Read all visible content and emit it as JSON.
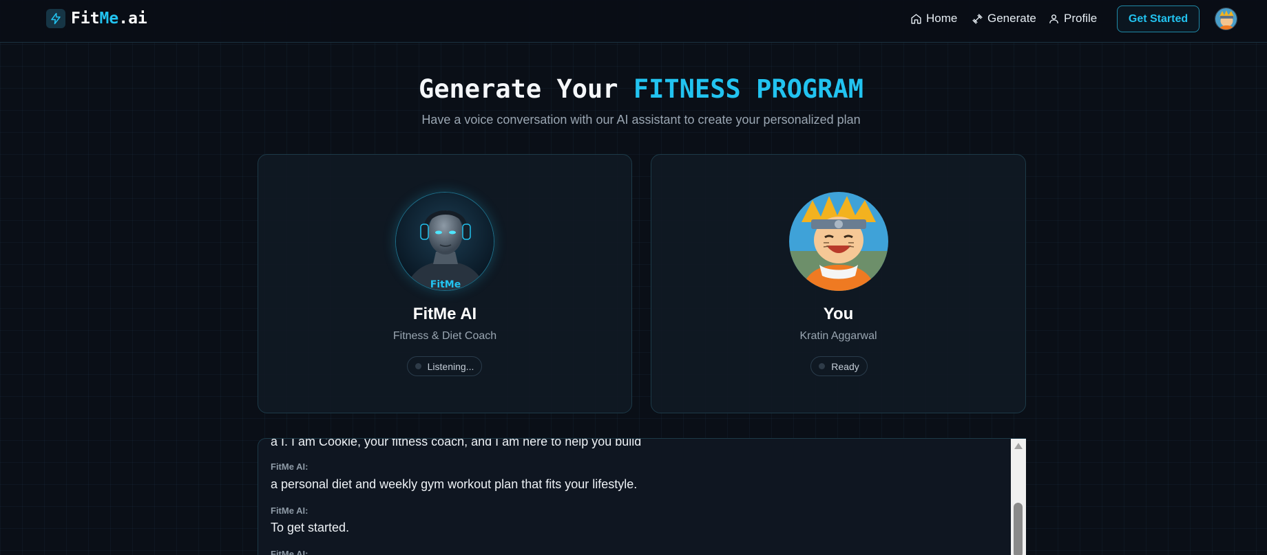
{
  "nav": {
    "brand_prefix": "Fit",
    "brand_accent": "Me",
    "brand_suffix": ".ai",
    "brand_icon": "lightning-bolt-icon",
    "links": [
      {
        "label": "Home",
        "icon": "home-icon"
      },
      {
        "label": "Generate",
        "icon": "dumbbell-icon"
      },
      {
        "label": "Profile",
        "icon": "user-icon"
      }
    ],
    "cta_label": "Get Started"
  },
  "hero": {
    "title_plain": "Generate Your ",
    "title_accent": "FITNESS PROGRAM",
    "subtitle": "Have a voice conversation with our AI assistant to create your personalized plan"
  },
  "cards": {
    "ai": {
      "name": "FitMe AI",
      "role": "Fitness & Diet Coach",
      "status": "Listening...",
      "portrait_caption": "FitMe"
    },
    "user": {
      "name": "You",
      "role": "Kratin Aggarwal",
      "status": "Ready"
    }
  },
  "transcript": {
    "messages": [
      {
        "label": "",
        "text": "a I. I am Cookie, your fitness coach, and I am here to help you build"
      },
      {
        "label": "FitMe AI:",
        "text": "a personal diet and weekly gym workout plan that fits your lifestyle."
      },
      {
        "label": "FitMe AI:",
        "text": "To get started."
      },
      {
        "label": "FitMe AI:",
        "text": ""
      }
    ]
  },
  "colors": {
    "accent": "#22c3f0",
    "background": "#0a0f17",
    "card": "#101924"
  }
}
